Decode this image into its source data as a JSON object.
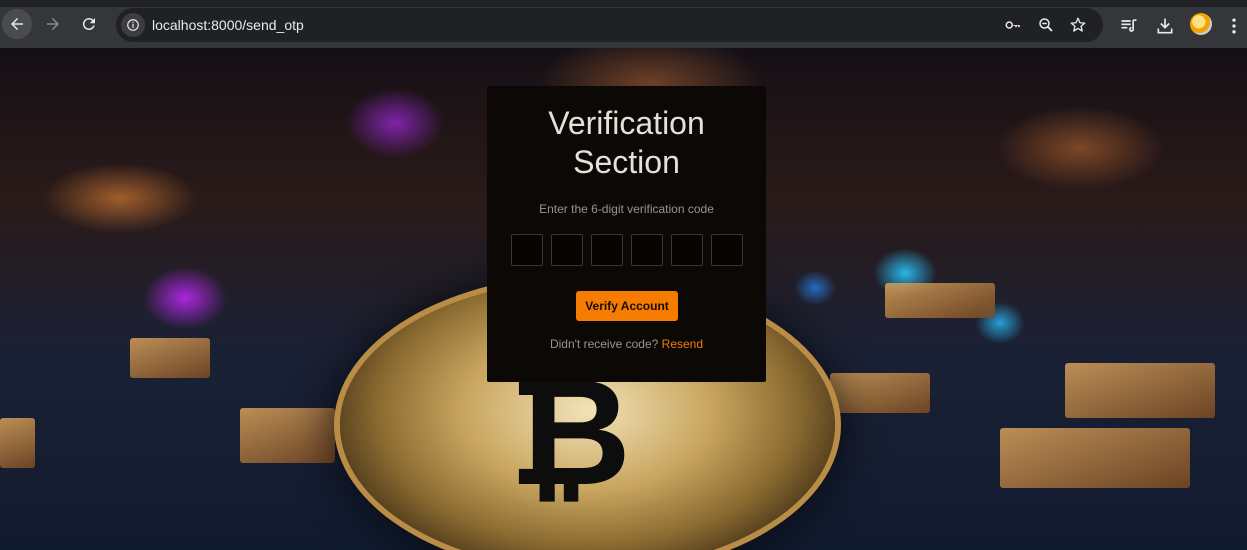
{
  "browser": {
    "url": "localhost:8000/send_otp",
    "icons": [
      "back-icon",
      "forward-icon",
      "reload-icon",
      "site-info-icon",
      "key-icon",
      "zoom-icon",
      "star-icon",
      "reading-list-icon",
      "download-icon",
      "avatar",
      "menu-icon"
    ]
  },
  "card": {
    "title_line1": "Verification",
    "title_line2": "Section",
    "subtitle": "Enter the 6-digit verification code",
    "otp_digits": 6,
    "verify_label": "Verify Account",
    "resend_prompt": "Didn't receive code?",
    "resend_link": "Resend"
  },
  "colors": {
    "accent": "#f57c00",
    "card_bg": "#0b0806",
    "chrome_bg": "#35363a"
  }
}
